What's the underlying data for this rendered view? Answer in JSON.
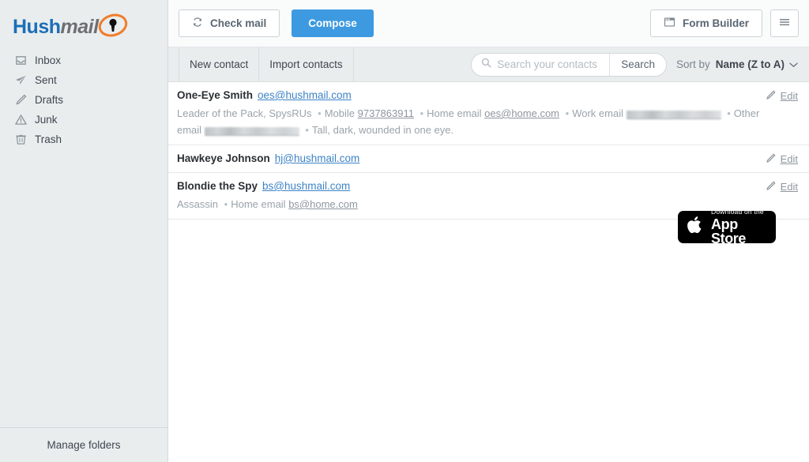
{
  "brand": {
    "logo_hush": "Hush",
    "logo_mail": "mail",
    "accent_blue": "#1d6eb7",
    "accent_orange": "#f07d2a",
    "primary_button": "#3d9ae0"
  },
  "sidebar": {
    "items": [
      {
        "label": "Inbox",
        "icon": "inbox-icon"
      },
      {
        "label": "Sent",
        "icon": "paper-plane-icon"
      },
      {
        "label": "Drafts",
        "icon": "pencil-icon"
      },
      {
        "label": "Junk",
        "icon": "warning-triangle-icon"
      },
      {
        "label": "Trash",
        "icon": "trash-icon"
      }
    ],
    "footer": "Manage folders"
  },
  "toolbar": {
    "check_mail": "Check mail",
    "check_mail_icon": "refresh-icon",
    "compose": "Compose",
    "form_builder": "Form Builder",
    "form_builder_icon": "form-window-icon",
    "menu_icon": "hamburger-menu-icon"
  },
  "subbar": {
    "new_contact": "New contact",
    "import_contacts": "Import contacts",
    "search_placeholder": "Search your contacts",
    "search_value": "",
    "search_icon": "search-icon",
    "search_button": "Search",
    "sort_label": "Sort by",
    "sort_value": "Name (Z to A)",
    "sort_chevron_icon": "chevron-down-icon"
  },
  "contacts": [
    {
      "name": "One-Eye Smith",
      "email": "oes@hushmail.com",
      "edit": "Edit",
      "edit_icon": "pencil-icon",
      "details": [
        {
          "type": "text",
          "text": "Leader of the Pack, SpysRUs"
        },
        {
          "type": "sep",
          "text": "•"
        },
        {
          "type": "text",
          "text": "Mobile"
        },
        {
          "type": "link",
          "text": "9737863911"
        },
        {
          "type": "sep",
          "text": "•"
        },
        {
          "type": "text",
          "text": "Home email"
        },
        {
          "type": "link",
          "text": "oes@home.com"
        },
        {
          "type": "sep",
          "text": "•"
        },
        {
          "type": "text",
          "text": "Work email"
        },
        {
          "type": "redacted",
          "width": 120
        },
        {
          "type": "sep",
          "text": "•"
        },
        {
          "type": "text",
          "text": "Other email"
        },
        {
          "type": "redacted",
          "width": 120
        },
        {
          "type": "sep",
          "text": "•"
        },
        {
          "type": "text",
          "text": "Tall, dark, wounded in one eye."
        }
      ]
    },
    {
      "name": "Hawkeye Johnson",
      "email": "hj@hushmail.com",
      "edit": "Edit",
      "edit_icon": "pencil-icon",
      "details": []
    },
    {
      "name": "Blondie the Spy",
      "email": "bs@hushmail.com",
      "edit": "Edit",
      "edit_icon": "pencil-icon",
      "details": [
        {
          "type": "text",
          "text": "Assassin"
        },
        {
          "type": "sep",
          "text": "•"
        },
        {
          "type": "text",
          "text": "Home email"
        },
        {
          "type": "link",
          "text": "bs@home.com"
        }
      ]
    }
  ],
  "appstore": {
    "small": "Download on the",
    "big": "App Store",
    "icon": "apple-logo-icon"
  }
}
